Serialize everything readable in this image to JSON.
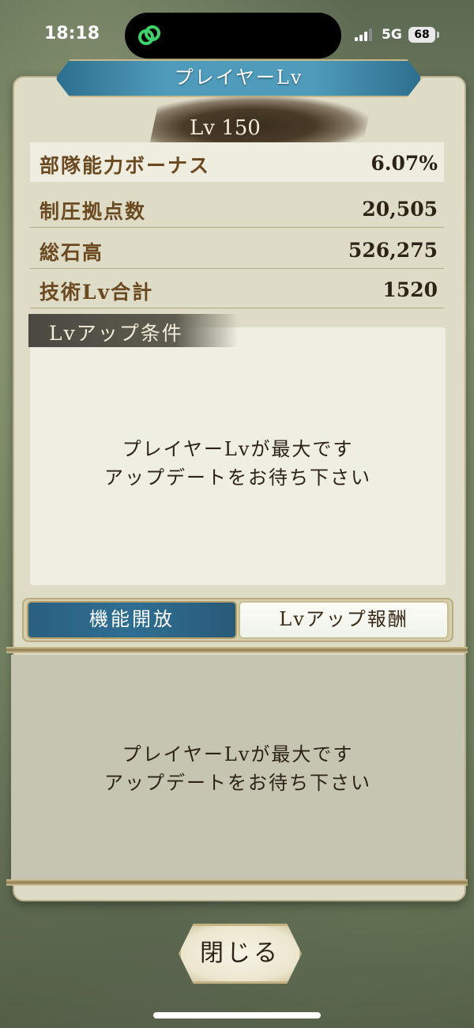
{
  "status_bar": {
    "time": "18:18",
    "network": "5G",
    "battery": "68"
  },
  "dialog": {
    "title": "プレイヤーLv",
    "level": "Lv 150"
  },
  "stats": [
    {
      "label": "部隊能力ボーナス",
      "value": "6.07%"
    },
    {
      "label": "制圧拠点数",
      "value": "20,505"
    },
    {
      "label": "総石高",
      "value": "526,275"
    },
    {
      "label": "技術Lv合計",
      "value": "1520"
    }
  ],
  "conditions": {
    "heading": "Lvアップ条件",
    "message_line1": "プレイヤーLvが最大です",
    "message_line2": "アップデートをお待ち下さい"
  },
  "tabs": [
    {
      "label": "機能開放",
      "active": true
    },
    {
      "label": "Lvアップ報酬",
      "active": false
    }
  ],
  "reward": {
    "message_line1": "プレイヤーLvが最大です",
    "message_line2": "アップデートをお待ち下さい"
  },
  "close_label": "閉じる",
  "colors": {
    "accent_blue": "#2f6e92",
    "panel_bg": "#dedbc7",
    "label_brown": "#6b4a22"
  }
}
